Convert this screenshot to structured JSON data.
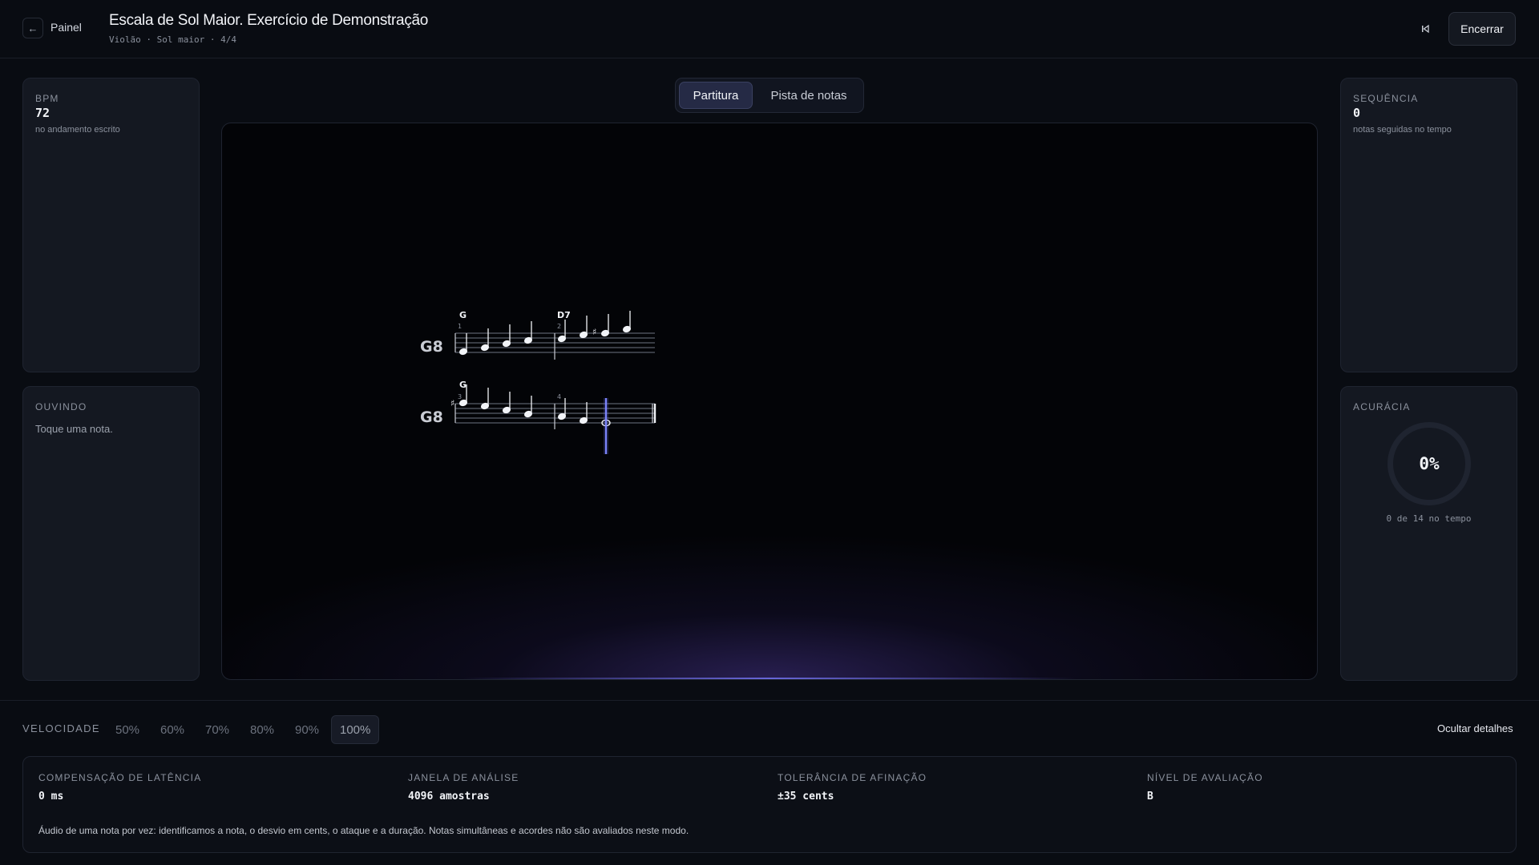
{
  "header": {
    "back_label": "Painel",
    "title": "Escala de Sol Maior. Exercício de Demonstração",
    "subtitle": "Violão · Sol maior · 4/4",
    "end_label": "Encerrar"
  },
  "left": {
    "bpm": {
      "label": "BPM",
      "value": "72",
      "note": "no andamento escrito"
    },
    "listening": {
      "label": "OUVINDO",
      "text": "Toque uma nota."
    }
  },
  "right": {
    "streak": {
      "label": "SEQUÊNCIA",
      "value": "0",
      "note": "notas seguidas no tempo"
    },
    "accuracy": {
      "label": "ACURÁCIA",
      "value": "0%",
      "note": "0 de 14 no tempo",
      "fraction": 0
    }
  },
  "tabs": [
    {
      "label": "Partitura",
      "active": true
    },
    {
      "label": "Pista de notas",
      "active": false
    }
  ],
  "score": {
    "systems": [
      {
        "clef": "G8",
        "chords": [
          "G",
          "D7"
        ],
        "measure_numbers": [
          "1",
          "2"
        ]
      },
      {
        "clef": "G8",
        "chords": [
          "G"
        ],
        "measure_numbers": [
          "3",
          "4"
        ]
      }
    ],
    "accidental": "♯"
  },
  "speed": {
    "label": "VELOCIDADE",
    "options": [
      "50%",
      "60%",
      "70%",
      "80%",
      "90%",
      "100%"
    ],
    "selected": "100%",
    "hide_details": "Ocultar detalhes"
  },
  "details": {
    "latency": {
      "label": "COMPENSAÇÃO DE LATÊNCIA",
      "value": "0 ms"
    },
    "window": {
      "label": "JANELA DE ANÁLISE",
      "value": "4096 amostras"
    },
    "tolerance": {
      "label": "TOLERÂNCIA DE AFINAÇÃO",
      "value": "±35 cents"
    },
    "level": {
      "label": "NÍVEL DE AVALIAÇÃO",
      "value": "B"
    },
    "note": "Áudio de uma nota por vez: identificamos a nota, o desvio em cents, o ataque e a duração. Notas simultâneas e acordes não são avaliados neste modo."
  },
  "colors": {
    "accent": "#6f79ff",
    "panel": "#141821",
    "background": "#090c12"
  }
}
